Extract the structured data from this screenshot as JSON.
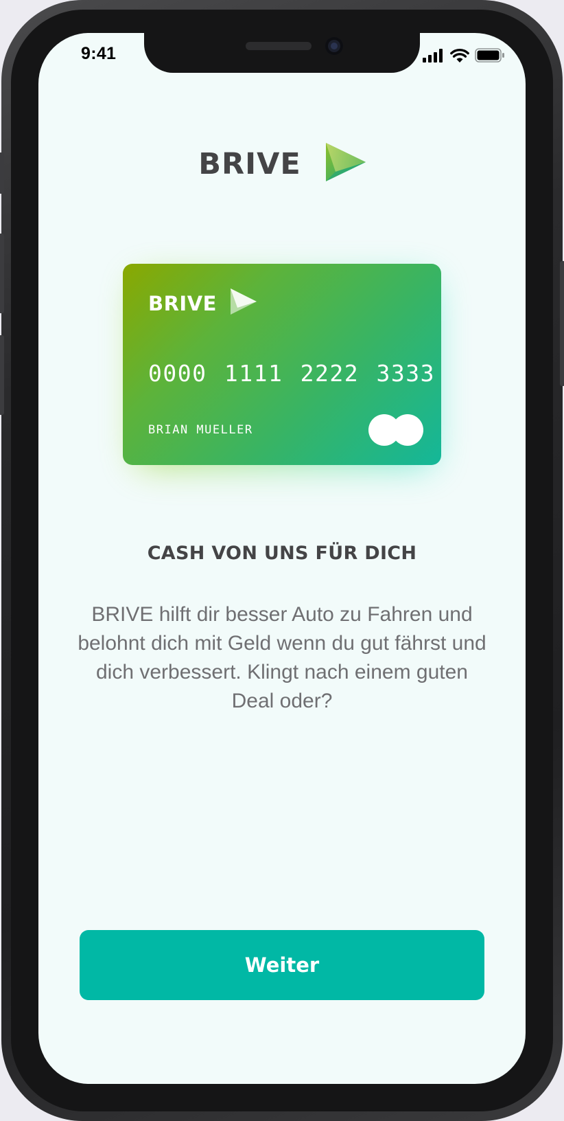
{
  "status_bar": {
    "time": "9:41",
    "icons": [
      "cellular-signal-icon",
      "wifi-icon",
      "battery-icon"
    ]
  },
  "header": {
    "brand": "BRIVE",
    "logo_icon": "play-triangle-icon"
  },
  "card": {
    "brand": "BRIVE",
    "number": "0000 1111 2222 3333",
    "holder": "BRIAN MUELLER",
    "network_icon": "card-network-circles-icon",
    "gradient_start": "#8aa800",
    "gradient_end": "#14b799"
  },
  "content": {
    "headline": "CASH VON UNS FÜR DICH",
    "body": "BRIVE hilft dir besser Auto zu Fahren und belohnt dich mit Geld wenn du gut fährst und dich verbessert. Klingt nach einem guten Deal oder?"
  },
  "actions": {
    "continue_label": "Weiter"
  },
  "colors": {
    "accent": "#01b8a5",
    "screen_background": "#f2fbfa",
    "text_dark": "#444446",
    "text_muted": "#6f6f72"
  }
}
